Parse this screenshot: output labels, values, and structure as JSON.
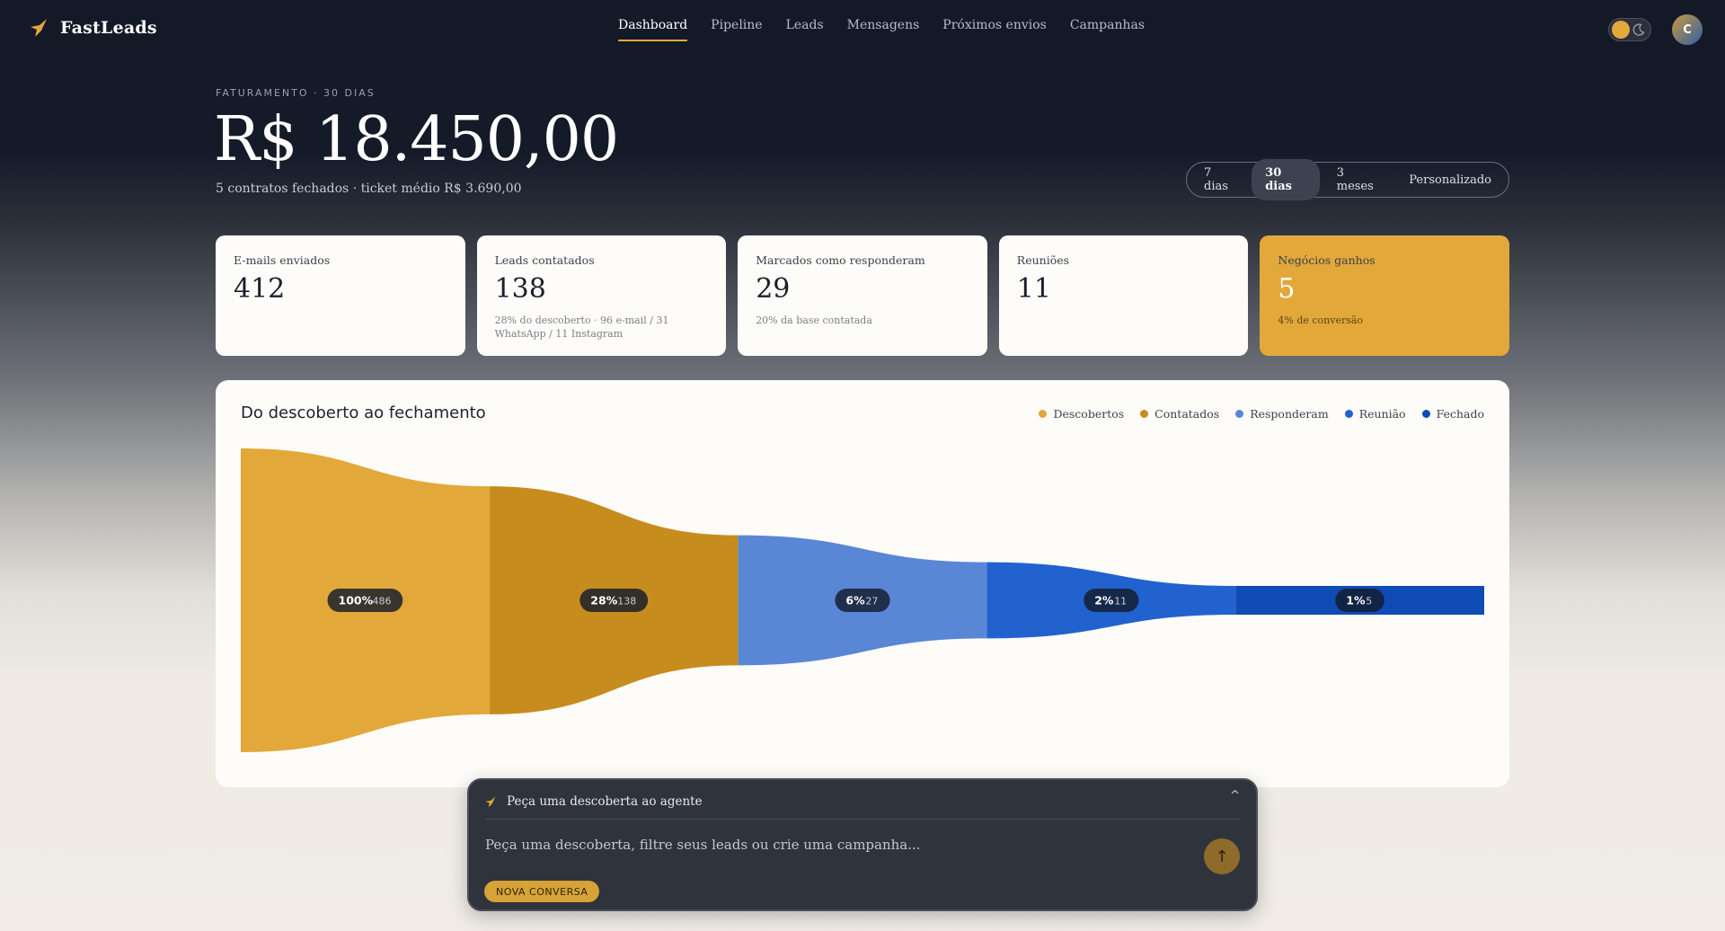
{
  "app": {
    "name": "FastLeads",
    "avatar_initial": "C"
  },
  "nav": {
    "items": [
      "Dashboard",
      "Pipeline",
      "Leads",
      "Mensagens",
      "Próximos envios",
      "Campanhas"
    ],
    "active": "Dashboard"
  },
  "revenue": {
    "caption": "FATURAMENTO · 30 DIAS",
    "value": "R$ 18.450,00",
    "subtitle": "5 contratos fechados · ticket médio R$ 3.690,00"
  },
  "periods": {
    "options": [
      "7 dias",
      "30 dias",
      "3 meses",
      "Personalizado"
    ],
    "active": "30 dias"
  },
  "stats": [
    {
      "label": "E-mails enviados",
      "value": "412",
      "note": ""
    },
    {
      "label": "Leads contatados",
      "value": "138",
      "note": "28% do descoberto · 96 e-mail / 31 WhatsApp / 11 Instagram"
    },
    {
      "label": "Marcados como responderam",
      "value": "29",
      "note": "20% da base contatada"
    },
    {
      "label": "Reuniões",
      "value": "11",
      "note": ""
    },
    {
      "label": "Negócios ganhos",
      "value": "5",
      "note": "4% de conversão"
    }
  ],
  "funnel": {
    "title": "Do descoberto ao fechamento",
    "colors": [
      "#e3a83a",
      "#c78c1e",
      "#5a86d6",
      "#2262cf",
      "#0f4bb4"
    ]
  },
  "chart_data": {
    "type": "funnel",
    "title": "Do descoberto ao fechamento",
    "categories": [
      "Descobertos",
      "Contatados",
      "Responderam",
      "Reunião",
      "Fechado"
    ],
    "values": [
      486,
      138,
      27,
      11,
      5
    ],
    "percent_labels": [
      "100%",
      "28%",
      "6%",
      "2%",
      "1%"
    ],
    "legend_position": "top-right",
    "grid": false
  },
  "agent": {
    "title": "Peça uma descoberta ao agente",
    "placeholder": "Peça uma descoberta, filtre seus leads ou crie uma campanha...",
    "caret": "^",
    "send": "↑",
    "new_conversation": "NOVA CONVERSA"
  }
}
